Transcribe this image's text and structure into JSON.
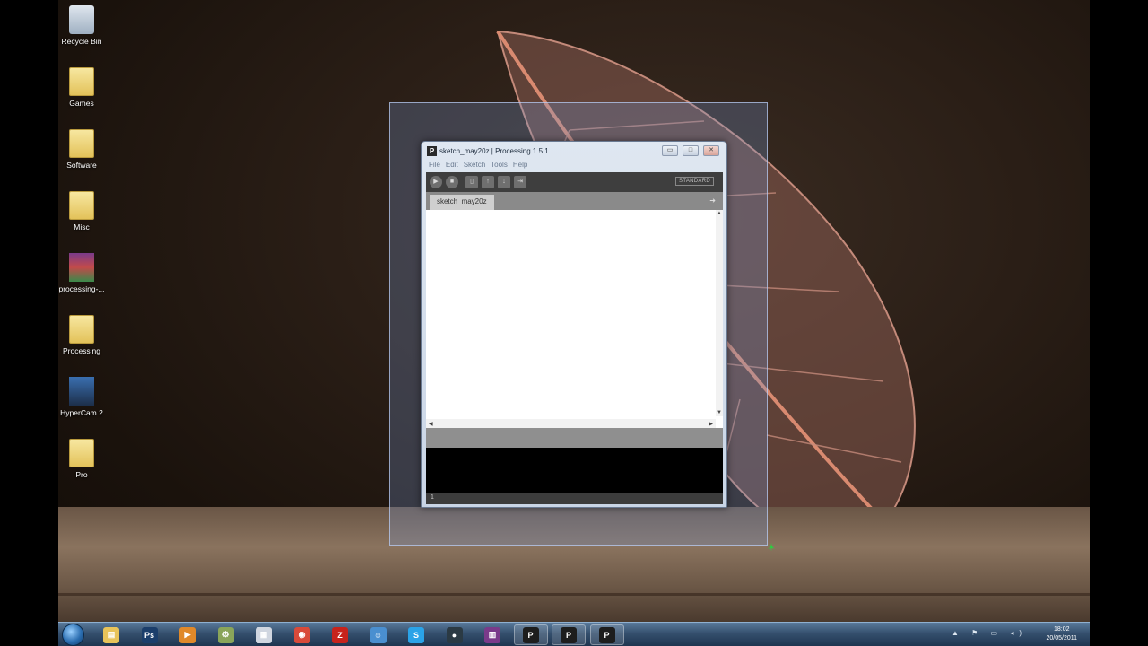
{
  "desktop": {
    "icons": [
      {
        "label": "Recycle Bin",
        "icon": "recycle-bin-icon"
      },
      {
        "label": "Games",
        "icon": "folder-icon"
      },
      {
        "label": "Software",
        "icon": "folder-icon"
      },
      {
        "label": "Misc",
        "icon": "folder-icon"
      },
      {
        "label": "processing-...",
        "icon": "archive-icon"
      },
      {
        "label": "Processing",
        "icon": "folder-icon"
      },
      {
        "label": "HyperCam 2",
        "icon": "hypercam-icon"
      },
      {
        "label": "Pro",
        "icon": "folder-icon"
      }
    ]
  },
  "window": {
    "title": "sketch_may20z | Processing 1.5.1",
    "app_icon_letter": "P",
    "buttons": {
      "minimize": "▭",
      "maximize": "□",
      "close": "✕"
    },
    "menu": [
      "File",
      "Edit",
      "Sketch",
      "Tools",
      "Help"
    ],
    "toolbar": {
      "buttons": [
        {
          "name": "run",
          "glyph": "▶"
        },
        {
          "name": "stop",
          "glyph": "■"
        },
        {
          "name": "new",
          "glyph": "▯"
        },
        {
          "name": "open",
          "glyph": "↑"
        },
        {
          "name": "save",
          "glyph": "↓"
        },
        {
          "name": "export",
          "glyph": "⇥"
        }
      ],
      "mode": "STANDARD"
    },
    "tab": {
      "label": "sketch_may20z",
      "arrow": "➜"
    },
    "editor": {
      "code": ""
    },
    "status_line": "1"
  },
  "taskbar": {
    "start_label": "",
    "apps": [
      {
        "name": "explorer",
        "glyph": "▤",
        "color": "#e8c35a"
      },
      {
        "name": "photoshop",
        "glyph": "Ps",
        "color": "#1b3e6b"
      },
      {
        "name": "media-player",
        "glyph": "▶",
        "color": "#e0892a"
      },
      {
        "name": "app-tools",
        "glyph": "⚙",
        "color": "#8aa55a"
      },
      {
        "name": "calendar",
        "glyph": "▦",
        "color": "#d0d6e0"
      },
      {
        "name": "chrome",
        "glyph": "◉",
        "color": "#d94a3a"
      },
      {
        "name": "filezilla",
        "glyph": "Z",
        "color": "#c7231c"
      },
      {
        "name": "messenger",
        "glyph": "☺",
        "color": "#4a8fd0"
      },
      {
        "name": "skype",
        "glyph": "S",
        "color": "#2aa3e8"
      },
      {
        "name": "media-center",
        "glyph": "●",
        "color": "#2b3a44"
      },
      {
        "name": "winrar",
        "glyph": "▥",
        "color": "#7a3a8a"
      },
      {
        "name": "processing-1",
        "glyph": "P",
        "color": "#1d1d1d"
      },
      {
        "name": "processing-2",
        "glyph": "P",
        "color": "#1d1d1d"
      },
      {
        "name": "processing-3",
        "glyph": "P",
        "color": "#1d1d1d"
      }
    ],
    "tray_icons": "▲ ⚑ ▭ ◂)",
    "clock": {
      "time": "18:02",
      "date": "20/05/2011"
    }
  }
}
